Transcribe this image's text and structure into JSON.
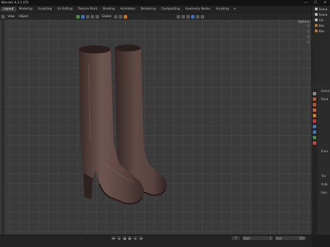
{
  "app": {
    "title": "Blender 4.3.1 LTS"
  },
  "window_controls": {
    "minimize": "—",
    "maximize": "☐",
    "close": "✕"
  },
  "workspaces": [
    "Layout",
    "Modeling",
    "Sculpting",
    "UV Editing",
    "Texture Paint",
    "Shading",
    "Animation",
    "Rendering",
    "Compositing",
    "Geometry Nodes",
    "Scripting"
  ],
  "workspace_add": "+",
  "viewport_header": {
    "view": "View",
    "object": "Object",
    "transform": "Global",
    "options": "Options"
  },
  "outliner": {
    "rows": [
      {
        "label": "Scene",
        "icon": "scene-icon"
      },
      {
        "label": "Scene",
        "icon": "collection-icon"
      },
      {
        "label": "Col",
        "icon": "collection-icon"
      },
      {
        "label": "Boo",
        "icon": "mesh-icon"
      },
      {
        "label": "Boo",
        "icon": "mesh-icon"
      }
    ]
  },
  "properties": {
    "labels": [
      "Scene",
      "Rend",
      "Fram",
      "Tim",
      "Outp",
      "Inpu"
    ]
  },
  "timeline": {
    "start_label": "Start",
    "start_value": "1",
    "end_label": "End",
    "end_value": "250",
    "current_frame": "1"
  },
  "colors": {
    "viewport_bg": "#3b3b3b",
    "boot_leather": "#5a4440",
    "boot_highlight": "#7a5f59",
    "boot_shadow": "#2e2220",
    "accent_blue": "#4772b3"
  }
}
